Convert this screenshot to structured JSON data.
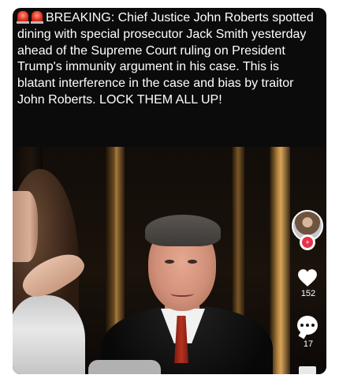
{
  "post": {
    "caption": "BREAKING: Chief Justice John Roberts spotted dining with special prosecutor Jack Smith yesterday ahead of the Supreme Court ruling on President Trump's immunity argument in his case. This is blatant interference in the case and bias by traitor John Roberts. LOCK THEM ALL UP!"
  },
  "rail": {
    "follow_symbol": "+",
    "likes": "152",
    "comments": "17"
  },
  "icons": {
    "siren": "police-siren-icon",
    "like": "heart-icon",
    "comment": "comment-bubble-icon",
    "share": "share-icon"
  },
  "colors": {
    "background": "#0b0b0b",
    "caption_text": "#ffffff",
    "follow_badge": "#e8304a",
    "tie": "#b8321f"
  }
}
